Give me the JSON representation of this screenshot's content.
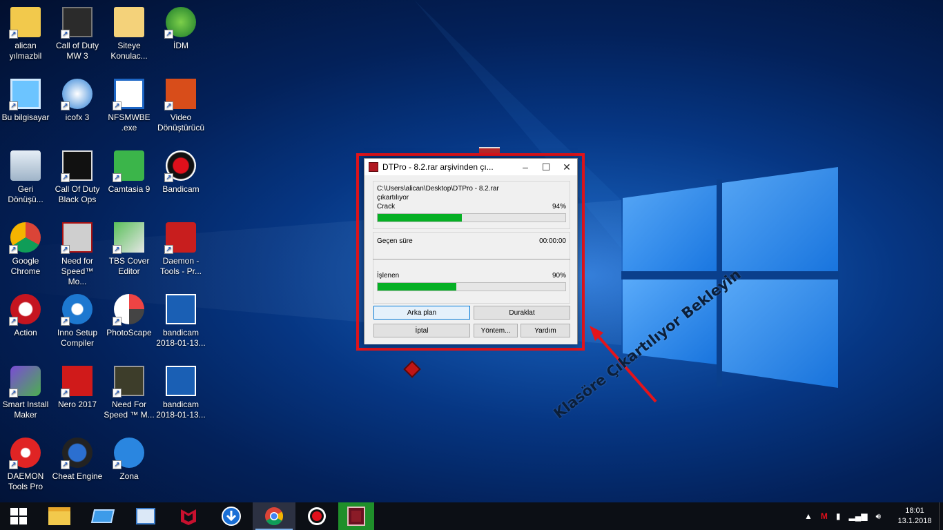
{
  "desktop_icons": [
    {
      "label": "alican\nyılmazbil",
      "icon": "user-folder-icon"
    },
    {
      "label": "Call of Duty\nMW 3",
      "icon": "cod-mw3-icon"
    },
    {
      "label": "Siteye\nKonulac...",
      "icon": "folder-icon"
    },
    {
      "label": "İDM",
      "icon": "idm-icon"
    },
    {
      "label": "Bu bilgisayar",
      "icon": "computer-icon"
    },
    {
      "label": "icofx 3",
      "icon": "icofx-icon"
    },
    {
      "label": "NFSMWBE\n.exe",
      "icon": "exe-icon"
    },
    {
      "label": "Video\nDönüştürücü",
      "icon": "video-converter-icon"
    },
    {
      "label": "Geri\nDönüşü...",
      "icon": "recycle-bin-icon"
    },
    {
      "label": "Call Of Duty\nBlack Ops",
      "icon": "cod-blackops-icon"
    },
    {
      "label": "Camtasia 9",
      "icon": "camtasia-icon"
    },
    {
      "label": "Bandicam",
      "icon": "bandicam-icon"
    },
    {
      "label": "Google\nChrome",
      "icon": "chrome-icon"
    },
    {
      "label": "Need for\nSpeed™ Mo...",
      "icon": "nfs-icon"
    },
    {
      "label": "TBS Cover\nEditor",
      "icon": "tbs-cover-icon"
    },
    {
      "label": "Daemon -\nTools -  Pr...",
      "icon": "daemon-icon"
    },
    {
      "label": "Action",
      "icon": "action-icon"
    },
    {
      "label": "Inno Setup\nCompiler",
      "icon": "inno-setup-icon"
    },
    {
      "label": "PhotoScape",
      "icon": "photoscape-icon"
    },
    {
      "label": "bandicam\n2018-01-13...",
      "icon": "video-file-icon"
    },
    {
      "label": "Smart Install\nMaker",
      "icon": "smart-install-icon"
    },
    {
      "label": "Nero 2017",
      "icon": "nero-icon"
    },
    {
      "label": "Need For\nSpeed ™ M...",
      "icon": "nfs-mw-icon"
    },
    {
      "label": "bandicam\n2018-01-13...",
      "icon": "video-file-icon"
    },
    {
      "label": "DAEMON\nTools Pro",
      "icon": "daemon-pro-icon"
    },
    {
      "label": "Cheat Engine",
      "icon": "cheat-engine-icon"
    },
    {
      "label": "Zona",
      "icon": "zona-icon"
    }
  ],
  "dialog": {
    "title": "DTPro - 8.2.rar arşivinden çı...",
    "path": "C:\\Users\\alican\\Desktop\\DTPro - 8.2.rar",
    "action": "çıkartılıyor",
    "file_name": "Crack",
    "file_percent": "94%",
    "file_progress": 0.45,
    "elapsed_label": "Geçen süre",
    "elapsed_value": "00:00:00",
    "processed_label": "İşlenen",
    "processed_percent": "90%",
    "processed_progress": 0.42,
    "buttons": {
      "background": "Arka plan",
      "pause": "Duraklat",
      "cancel": "İptal",
      "mode": "Yöntem...",
      "help": "Yardım"
    }
  },
  "annotation": "Klasöre Çıkartılıyor Bekleyin",
  "taskbar": {
    "items": [
      "start-icon",
      "file-explorer-icon",
      "app-icon",
      "icofx-taskbar-icon",
      "mcafee-icon",
      "download-icon",
      "chrome-icon",
      "bandicam-icon",
      "winrar-icon"
    ]
  },
  "clock": {
    "time": "18:01",
    "date": "13.1.2018"
  },
  "colors": {
    "accent_red": "#e3141b",
    "progress_green": "#06b025"
  }
}
